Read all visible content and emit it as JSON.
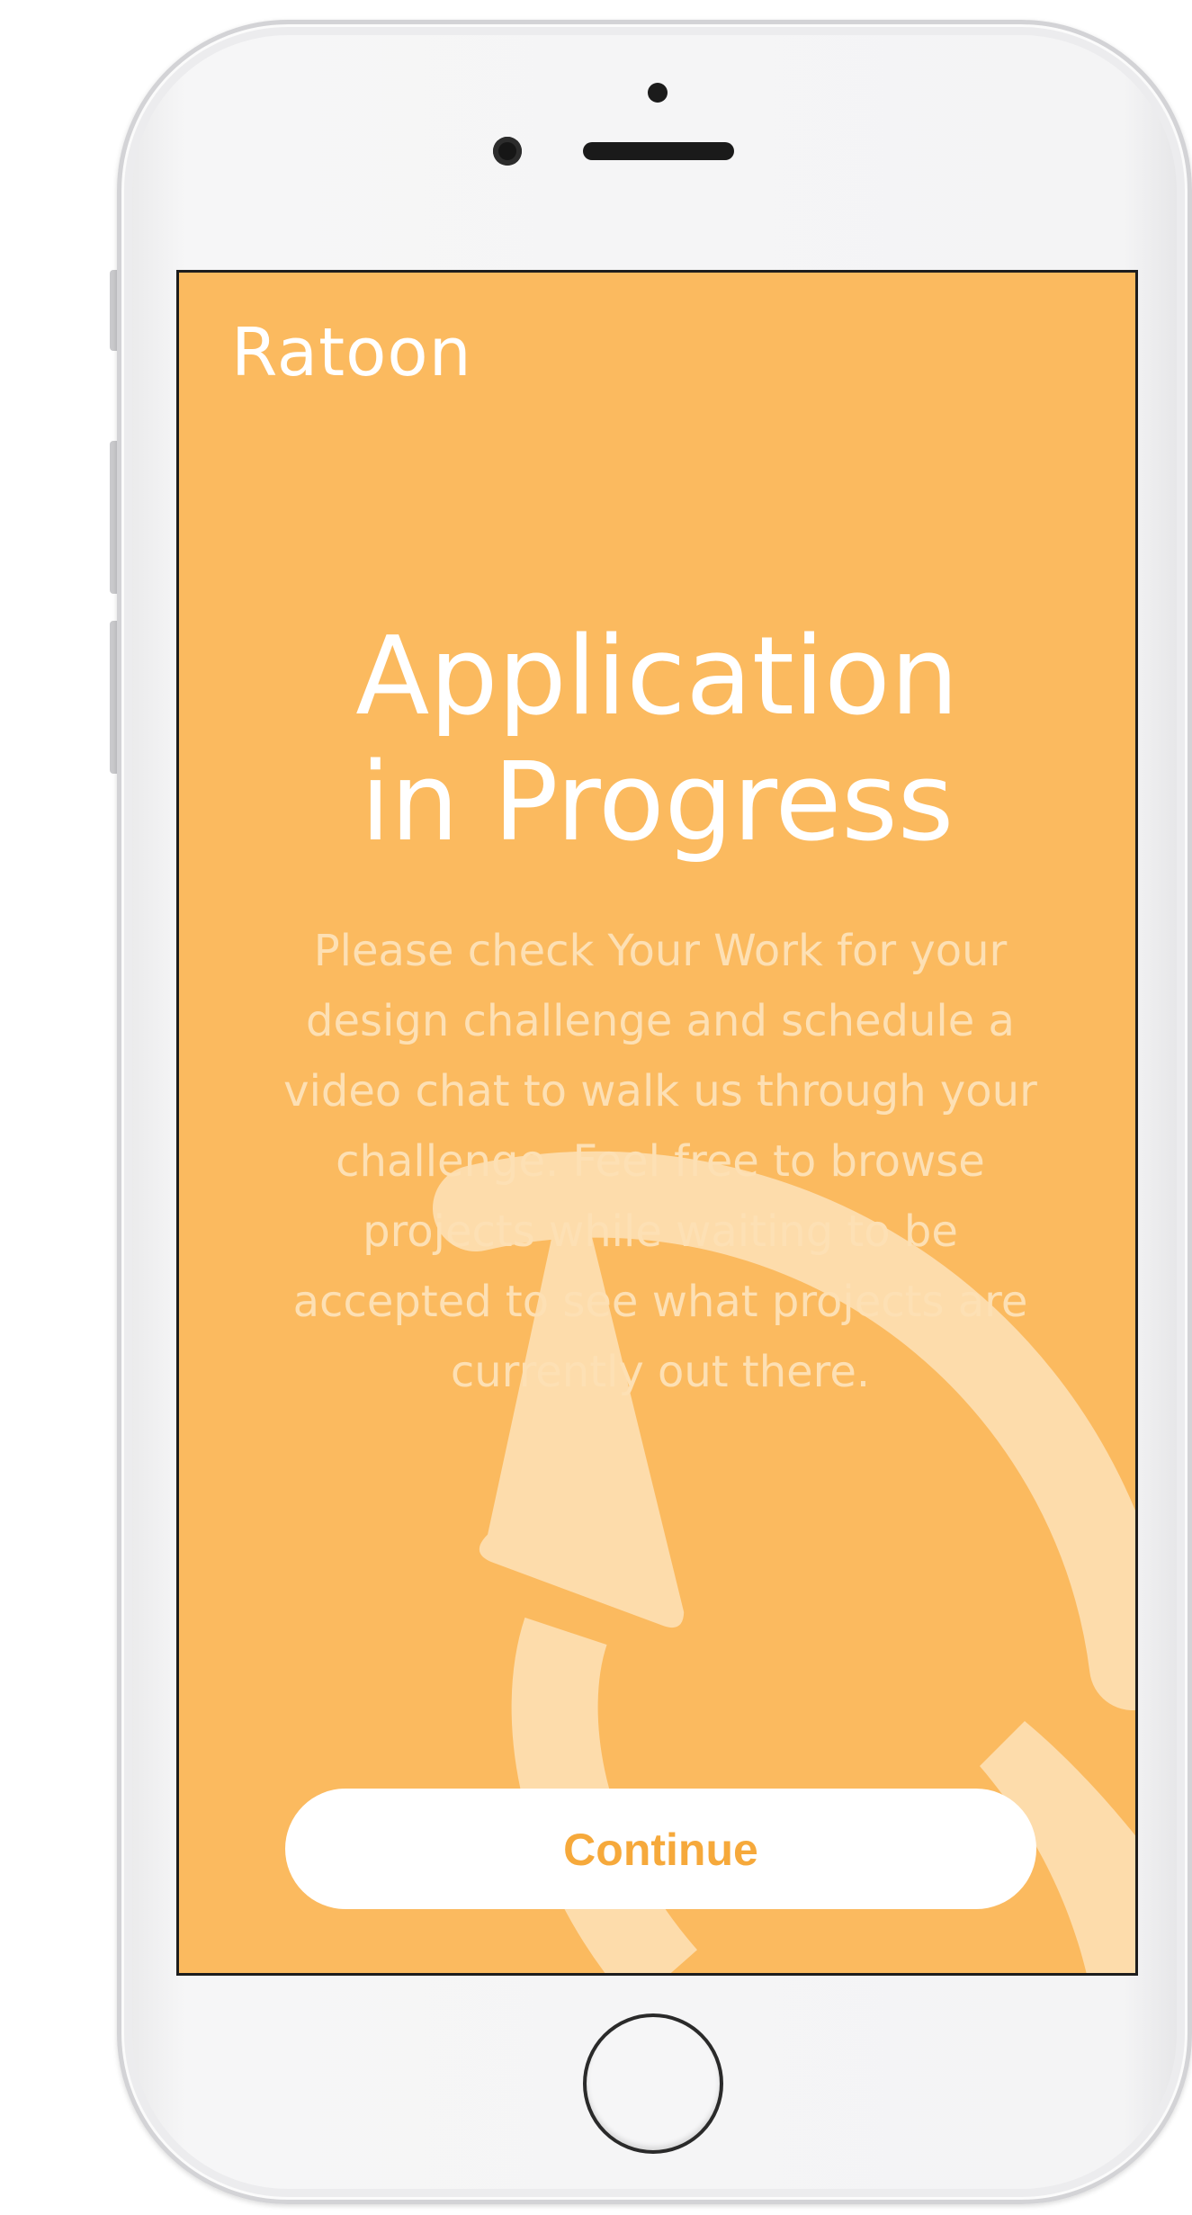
{
  "app": {
    "brand": "Ratoon",
    "headline": {
      "line1": "Application",
      "line2": "in Progress"
    },
    "message_lines": [
      "Please check Your Work for your",
      "design challenge and schedule a",
      "video chat to walk us through your",
      "challenge. Feel free to browse",
      "projects while waiting to be",
      "accepted to see what projects are",
      "currently out there."
    ],
    "continue_label": "Continue"
  },
  "colors": {
    "screen_background": "#fbba5f",
    "decorative_arrow": "#fddcab",
    "message_text": "#fde0b4",
    "button_text": "#f6a93b"
  },
  "icons": {
    "background_decoration": "circular-arrow-icon"
  }
}
